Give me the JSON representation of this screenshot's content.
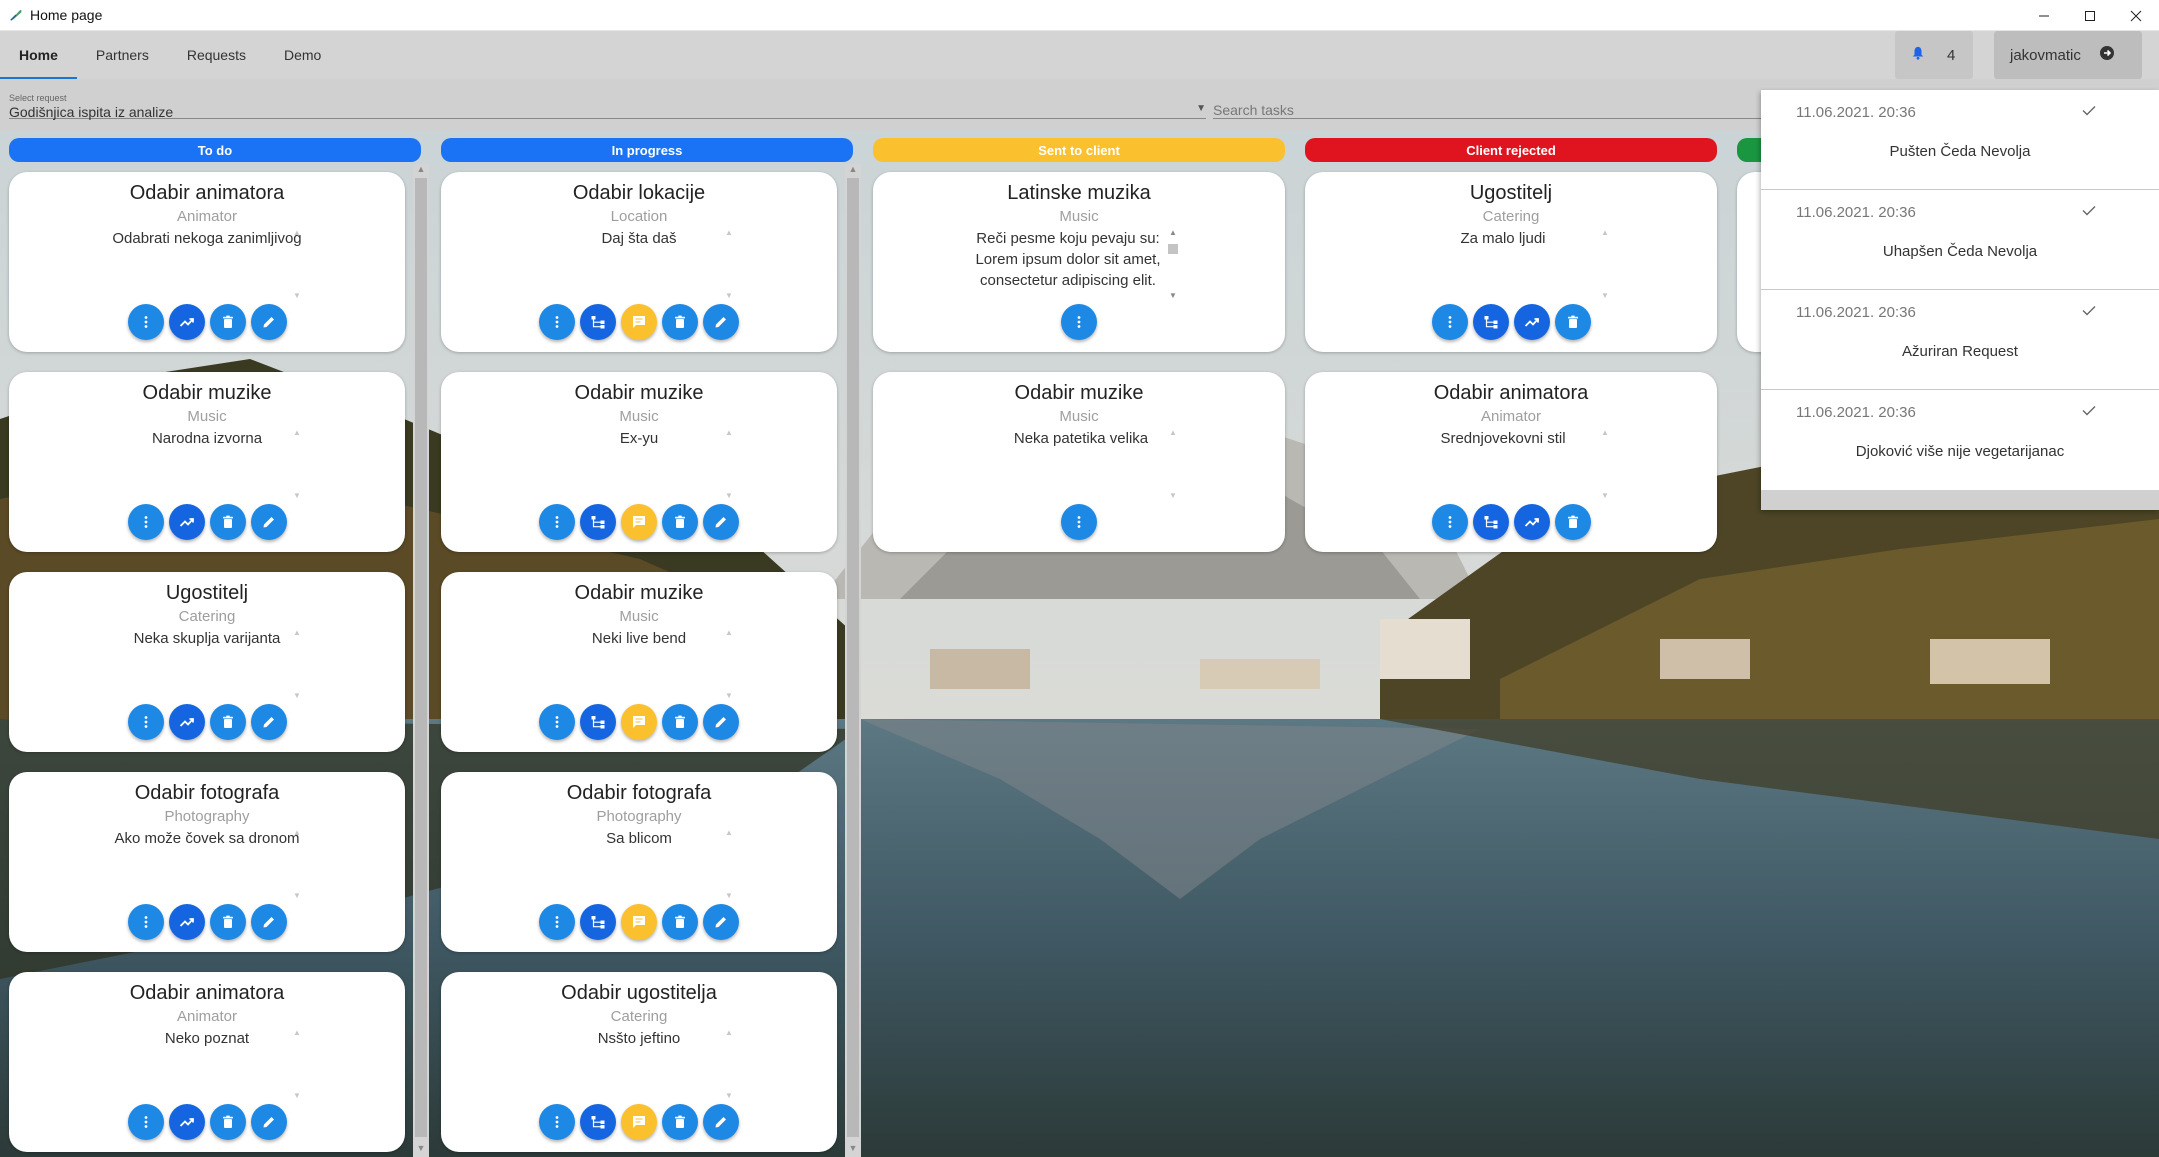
{
  "window": {
    "title": "Home page"
  },
  "nav": {
    "tabs": [
      {
        "label": "Home",
        "active": true
      },
      {
        "label": "Partners",
        "active": false
      },
      {
        "label": "Requests",
        "active": false
      },
      {
        "label": "Demo",
        "active": false
      }
    ],
    "notification_count": "4",
    "username": "jakovmatic"
  },
  "filters": {
    "select_caption": "Select request",
    "select_value": "Godišnjica ispita iz analize",
    "search_placeholder": "Search tasks"
  },
  "columns": [
    {
      "title": "To do",
      "color": "#1a73f5"
    },
    {
      "title": "In progress",
      "color": "#1a73f5"
    },
    {
      "title": "Sent to client",
      "color": "#fbc02d"
    },
    {
      "title": "Client rejected",
      "color": "#e0141e"
    },
    {
      "title": "",
      "color": "#1a9641"
    }
  ],
  "cards": {
    "todo": [
      {
        "title": "Odabir animatora",
        "type": "Animator",
        "desc": "Odabrati nekoga zanimljivog"
      },
      {
        "title": "Odabir muzike",
        "type": "Music",
        "desc": "Narodna izvorna"
      },
      {
        "title": "Ugostitelj",
        "type": "Catering",
        "desc": "Neka skuplja varijanta"
      },
      {
        "title": "Odabir fotografa",
        "type": "Photography",
        "desc": "Ako može čovek sa dronom"
      },
      {
        "title": "Odabir animatora",
        "type": "Animator",
        "desc": "Neko poznat"
      }
    ],
    "inprogress": [
      {
        "title": "Odabir lokacije",
        "type": "Location",
        "desc": "Daj šta daš"
      },
      {
        "title": "Odabir muzike",
        "type": "Music",
        "desc": "Ex-yu"
      },
      {
        "title": "Odabir muzike",
        "type": "Music",
        "desc": "Neki live bend"
      },
      {
        "title": "Odabir fotografa",
        "type": "Photography",
        "desc": "Sa blicom"
      },
      {
        "title": "Odabir ugostitelja",
        "type": "Catering",
        "desc": "Nsšto jeftino"
      }
    ],
    "sent": [
      {
        "title": "Latinske muzika",
        "type": "Music",
        "desc": "Reči pesme koju pevaju su: Lorem ipsum dolor sit amet, consectetur adipiscing elit. Quisque"
      },
      {
        "title": "Odabir muzike",
        "type": "Music",
        "desc": "Neka patetika velika"
      }
    ],
    "rejected": [
      {
        "title": "Ugostitelj",
        "type": "Catering",
        "desc": "Za malo ljudi"
      },
      {
        "title": "Odabir animatora",
        "type": "Animator",
        "desc": "Srednjovekovni stil"
      }
    ]
  },
  "notifications": [
    {
      "time": "11.06.2021. 20:36",
      "text": "Pušten Čeda Nevolja"
    },
    {
      "time": "11.06.2021. 20:36",
      "text": "Uhapšen Čeda Nevolja"
    },
    {
      "time": "11.06.2021. 20:36",
      "text": "Ažuriran Request"
    },
    {
      "time": "11.06.2021. 20:36",
      "text": "Djoković više nije vegetarijanac"
    }
  ]
}
